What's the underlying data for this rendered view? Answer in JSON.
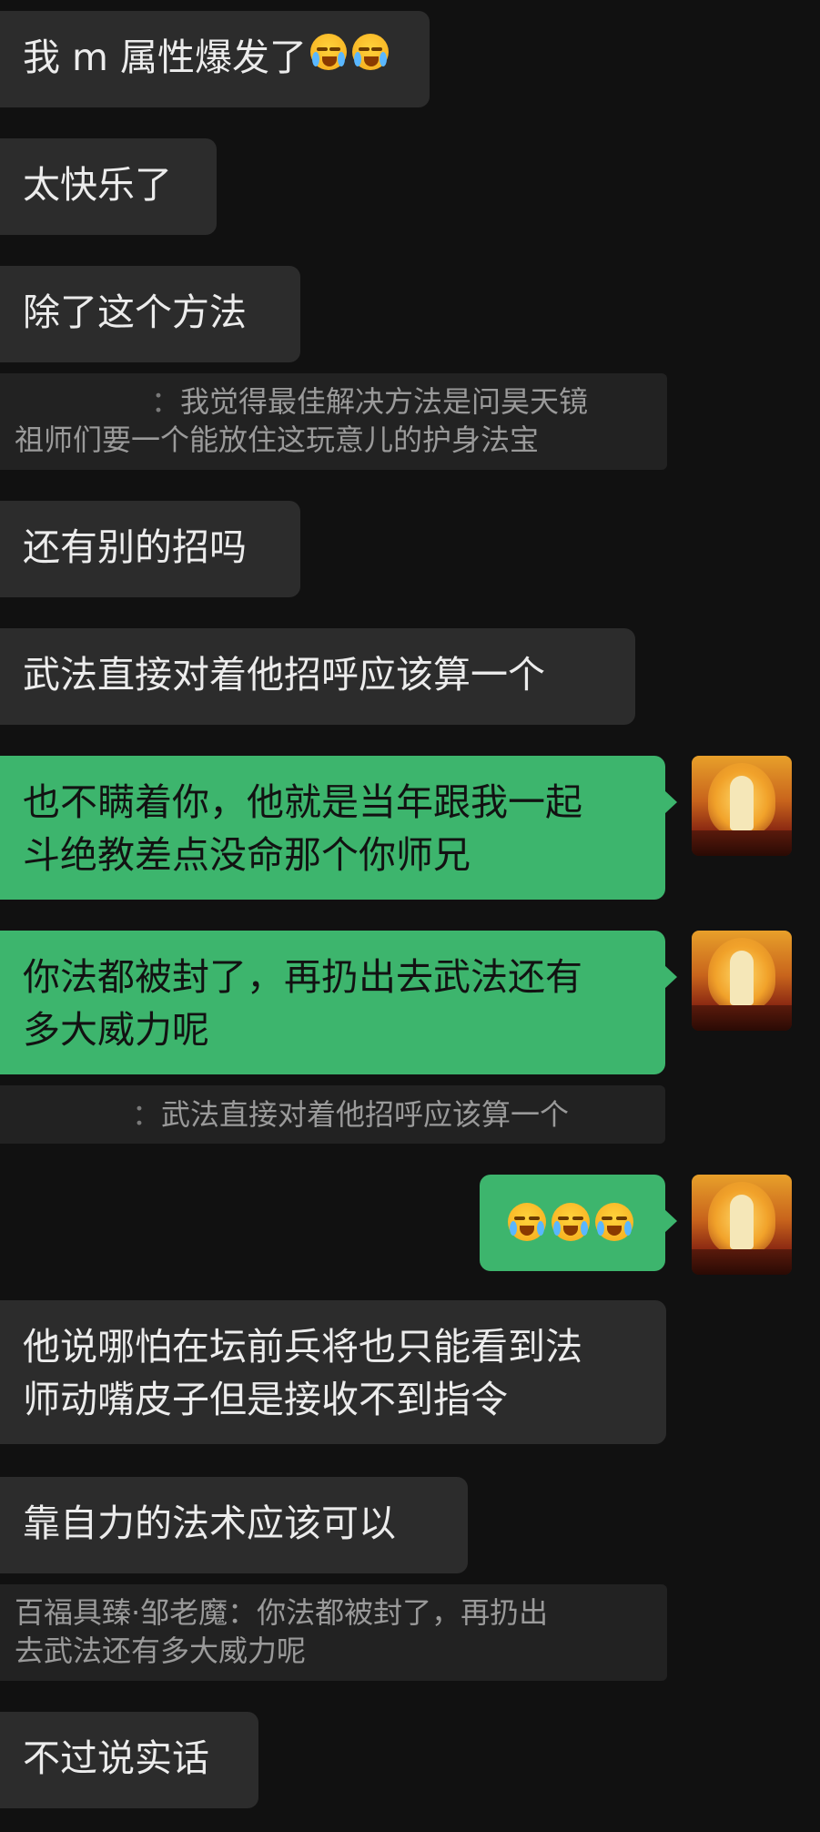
{
  "messages": [
    {
      "text": "我 m 属性爆发了"
    },
    {
      "text": "太快乐了"
    },
    {
      "text": "除了这个方法"
    },
    {
      "quote_sender_line1": "：",
      "quote_text_line1": "我觉得最佳解决方法是问昊天镜",
      "quote_line2": "祖师们要一个能放住这玩意儿的护身法宝"
    },
    {
      "text": "还有别的招吗"
    },
    {
      "text": "武法直接对着他招呼应该算一个"
    },
    {
      "line1": "也不瞒着你，他就是当年跟我一起",
      "line2": "斗绝教差点没命那个你师兄"
    },
    {
      "line1": "你法都被封了，再扔出去武法还有",
      "line2": "多大威力呢"
    },
    {
      "quote_prefix": "：",
      "quote_text": "武法直接对着他招呼应该算一个"
    },
    {
      "emoji": [
        "loudly-crying-face",
        "loudly-crying-face",
        "loudly-crying-face"
      ]
    },
    {
      "line1": "他说哪怕在坛前兵将也只能看到法",
      "line2": "师动嘴皮子但是接收不到指令"
    },
    {
      "text": "靠自力的法术应该可以"
    },
    {
      "quote_line1": "百福具臻·邹老魔：你法都被封了，再扔出",
      "quote_line2": "去武法还有多大威力呢"
    },
    {
      "text": "不过说实话"
    }
  ],
  "avatar": {
    "name": "temple-deity-avatar"
  },
  "colors": {
    "background": "#111111",
    "incoming_bubble": "#2c2c2c",
    "outgoing_bubble": "#3db56d",
    "quote_bg": "#222222"
  }
}
